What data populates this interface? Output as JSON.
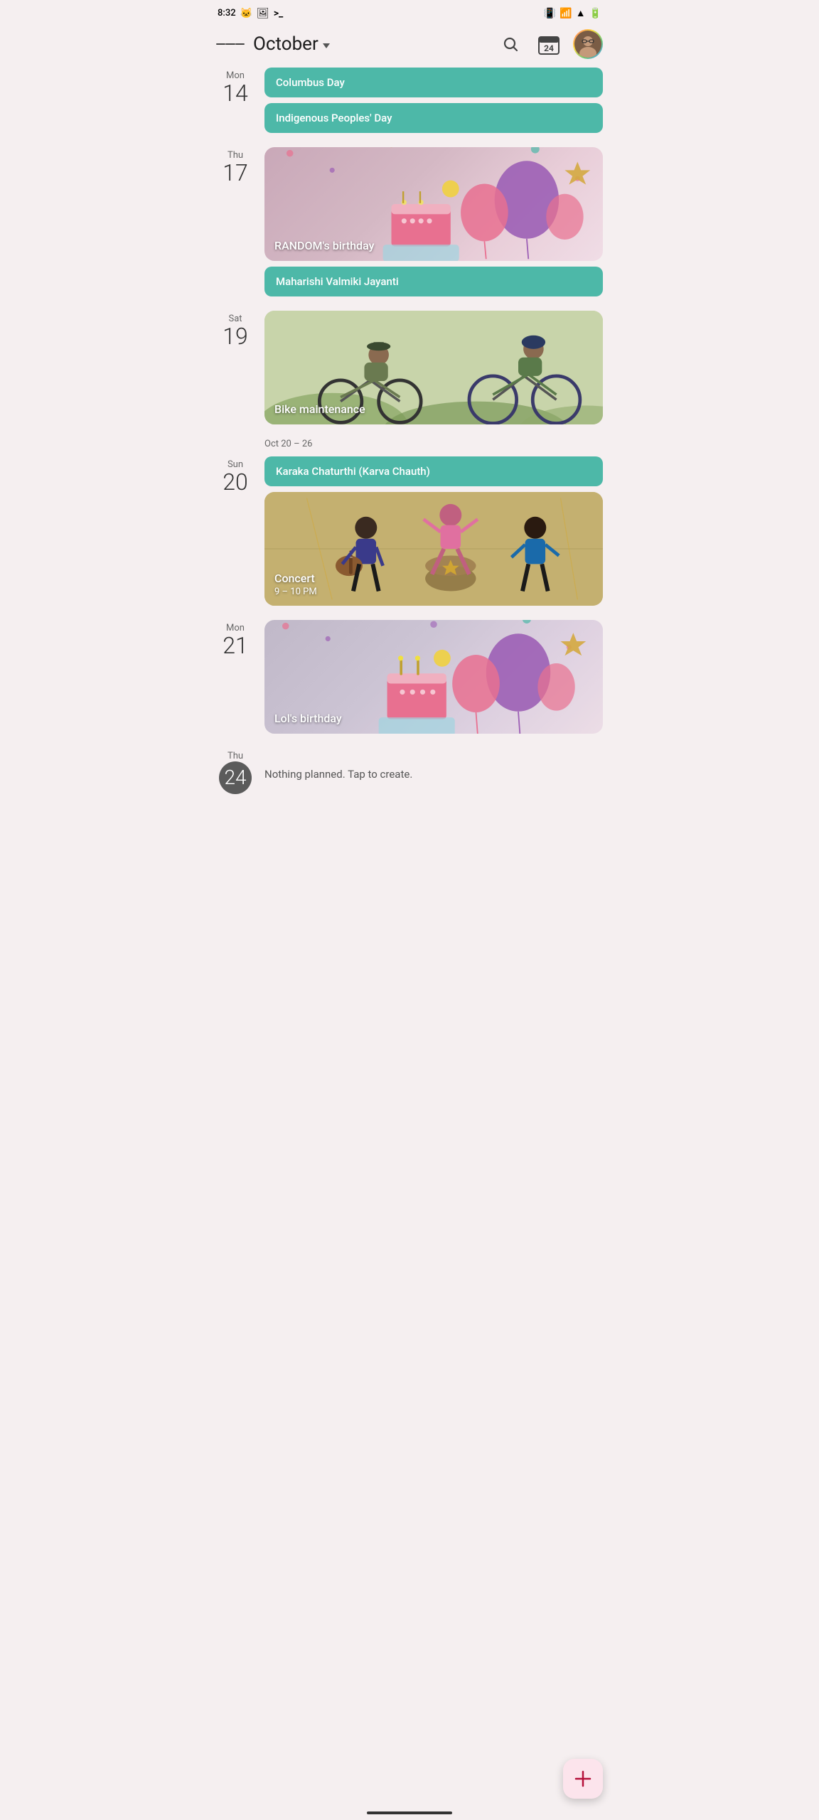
{
  "statusBar": {
    "time": "8:32",
    "icons": [
      "cat",
      "image",
      "terminal",
      "vibrate",
      "wifi",
      "signal",
      "battery"
    ]
  },
  "header": {
    "menuLabel": "Menu",
    "title": "October",
    "searchLabel": "Search",
    "calendarDate": "24",
    "avatarAlt": "User avatar"
  },
  "weekRangeLabel": "Oct 20 – 26",
  "events": [
    {
      "id": "mon14",
      "dayName": "Mon",
      "dayNum": "14",
      "isToday": false,
      "items": [
        {
          "type": "pill",
          "label": "Columbus Day"
        },
        {
          "type": "pill",
          "label": "Indigenous Peoples' Day"
        }
      ]
    },
    {
      "id": "thu17",
      "dayName": "Thu",
      "dayNum": "17",
      "isToday": false,
      "items": [
        {
          "type": "image-card",
          "label": "RANDOM's birthday",
          "sublabel": "",
          "theme": "birthday"
        },
        {
          "type": "pill",
          "label": "Maharishi Valmiki Jayanti"
        }
      ]
    },
    {
      "id": "sat19",
      "dayName": "Sat",
      "dayNum": "19",
      "isToday": false,
      "items": [
        {
          "type": "image-card",
          "label": "Bike maintenance",
          "sublabel": "",
          "theme": "bike"
        }
      ]
    },
    {
      "id": "sun20",
      "dayName": "Sun",
      "dayNum": "20",
      "isToday": false,
      "weekRange": "Oct 20 – 26",
      "items": [
        {
          "type": "pill",
          "label": "Karaka Chaturthi (Karva Chauth)"
        },
        {
          "type": "image-card",
          "label": "Concert",
          "sublabel": "9 – 10 PM",
          "theme": "concert"
        }
      ]
    },
    {
      "id": "mon21",
      "dayName": "Mon",
      "dayNum": "21",
      "isToday": false,
      "items": [
        {
          "type": "image-card",
          "label": "Lol's birthday",
          "sublabel": "",
          "theme": "lol-birthday"
        }
      ]
    },
    {
      "id": "thu24",
      "dayName": "Thu",
      "dayNum": "24",
      "isToday": true,
      "items": [
        {
          "type": "text",
          "label": "Nothing planned. Tap to create."
        }
      ]
    }
  ],
  "fab": {
    "label": "+"
  }
}
